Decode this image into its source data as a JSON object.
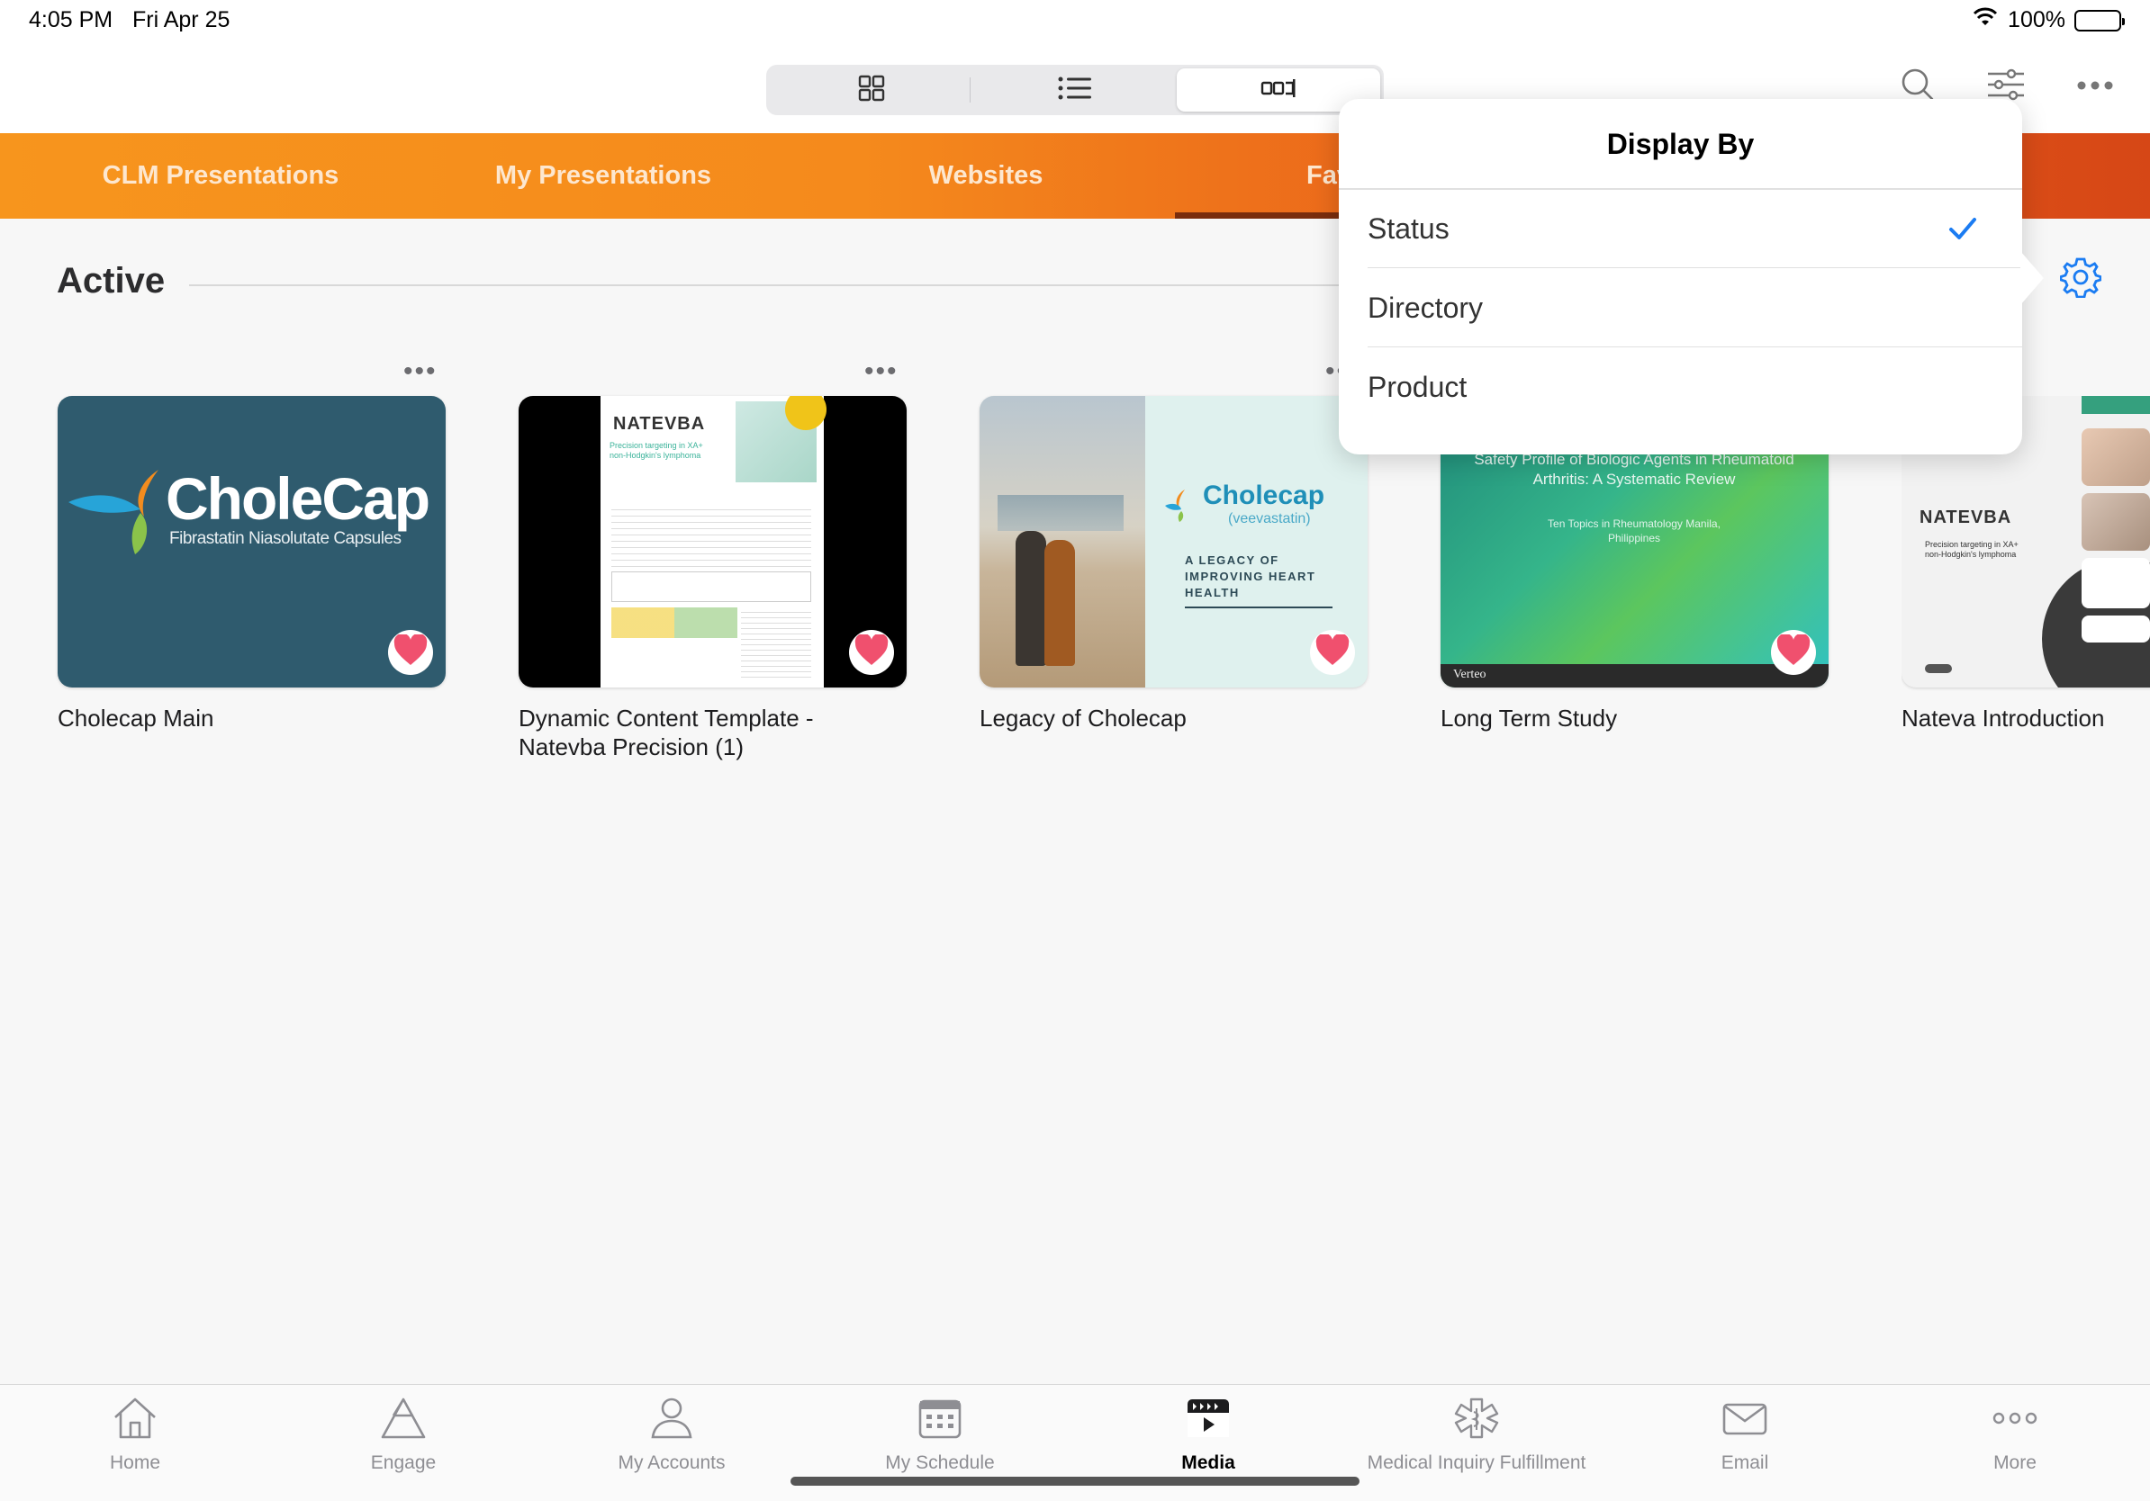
{
  "status_bar": {
    "time": "4:05 PM",
    "date": "Fri Apr 25",
    "battery": "100%"
  },
  "toolbar": {
    "view_modes": [
      {
        "icon": "grid-view-icon",
        "selected": false
      },
      {
        "icon": "list-view-icon",
        "selected": false
      },
      {
        "icon": "carousel-view-icon",
        "selected": true
      }
    ],
    "icons": [
      "search-icon",
      "filter-sliders-icon",
      "more-horizontal-icon"
    ]
  },
  "tabs": [
    {
      "label": "CLM Presentations"
    },
    {
      "label": "My Presentations"
    },
    {
      "label": "Websites"
    },
    {
      "label": "Favorites"
    }
  ],
  "section": {
    "title": "Active"
  },
  "cards": [
    {
      "title": "Cholecap Main",
      "favorite": true
    },
    {
      "title": "Dynamic Content Template - Natevba Precision (1)",
      "favorite": true
    },
    {
      "title": "Legacy of Cholecap",
      "favorite": true
    },
    {
      "title": "Long Term Study",
      "favorite": true
    },
    {
      "title": "Nateva Introduction",
      "favorite": false
    }
  ],
  "thumbs": {
    "cholecap_brand": "CholeCap",
    "cholecap_sub": "Fibrastatin Niasolutate Capsules",
    "natevba_brand": "NATEVBA",
    "natevba_tag": "Precision targeting in XA+ non-Hodgkin's lymphoma",
    "legacy_brand": "Cholecap",
    "legacy_sub": "(veevastatin)",
    "legacy_tag": "A LEGACY OF IMPROVING HEART HEALTH",
    "study_title": "Safety Profile of Biologic Agents in Rheumatoid Arthritis: A Systematic Review",
    "study_sub": "Ten Topics in Rheumatology Manila, Philippines",
    "study_logo": "Verteo",
    "nateva_brand": "NATEVBA",
    "nateva_tag": "Precision targeting in XA+ non-Hodgkin's lymphoma"
  },
  "popover": {
    "title": "Display By",
    "options": [
      {
        "label": "Status",
        "checked": true
      },
      {
        "label": "Directory",
        "checked": false
      },
      {
        "label": "Product",
        "checked": false
      }
    ]
  },
  "bottom_tabs": [
    {
      "label": "Home",
      "icon": "home-icon"
    },
    {
      "label": "Engage",
      "icon": "engage-icon"
    },
    {
      "label": "My Accounts",
      "icon": "accounts-icon"
    },
    {
      "label": "My Schedule",
      "icon": "calendar-icon"
    },
    {
      "label": "Media",
      "icon": "media-icon",
      "active": true
    },
    {
      "label": "Medical Inquiry Fulfillment",
      "icon": "medical-icon"
    },
    {
      "label": "Email",
      "icon": "email-icon"
    },
    {
      "label": "More",
      "icon": "more-icon"
    }
  ],
  "colors": {
    "accent": "#1b7cf2",
    "tab_start": "#f7951d",
    "tab_end": "#d64716",
    "heart": "#f0506e"
  }
}
